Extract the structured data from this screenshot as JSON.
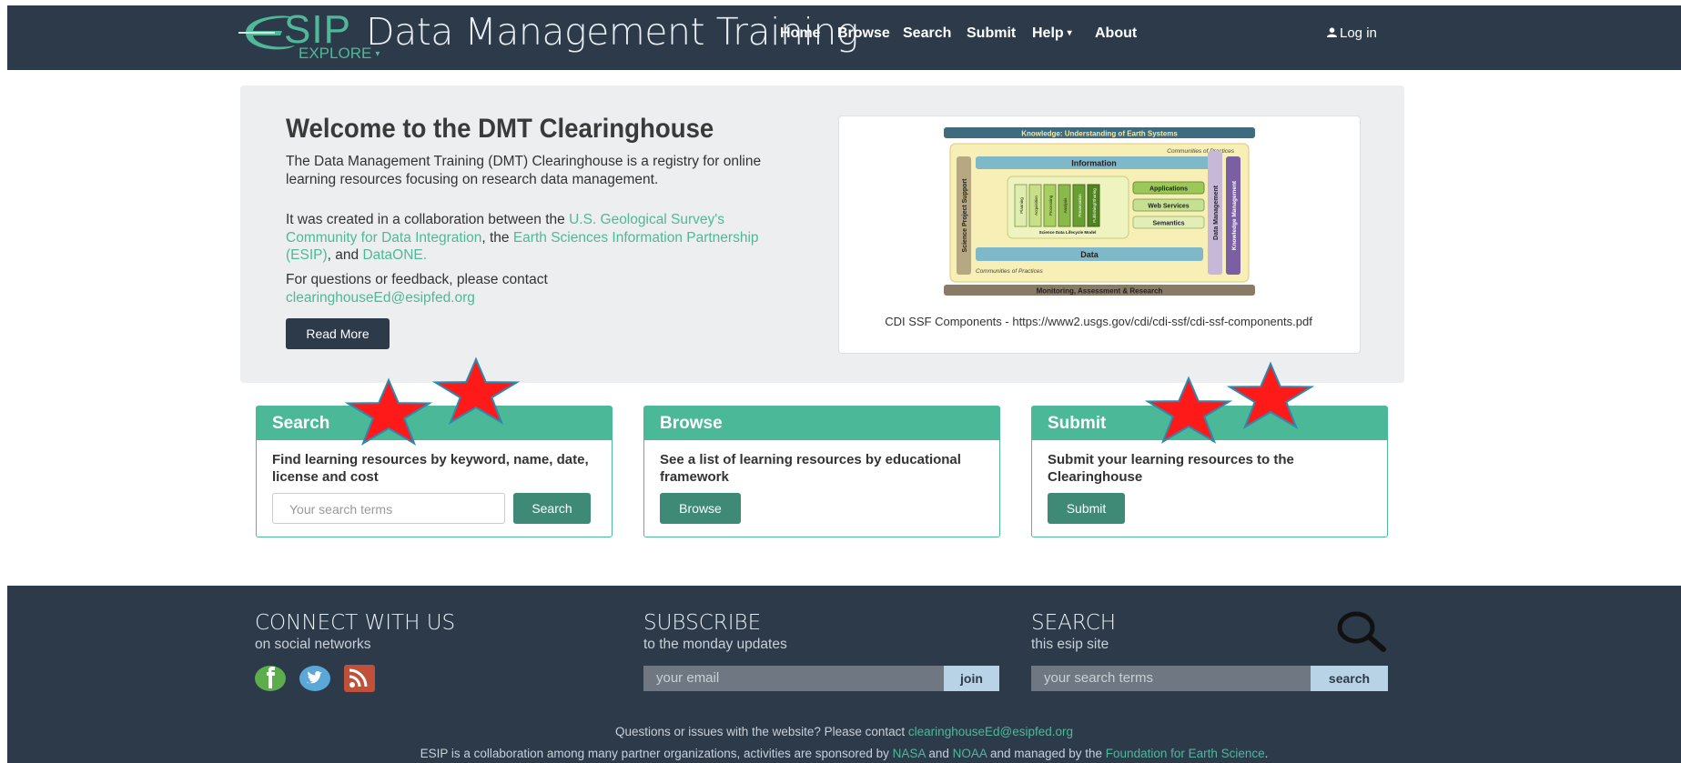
{
  "nav": {
    "logo_letters": "SIP",
    "brand_title": "Data Management Training",
    "explore_label": "EXPLORE",
    "items": [
      "Home",
      "Browse",
      "Search",
      "Submit",
      "Help",
      "About"
    ],
    "login": "Log in"
  },
  "hero": {
    "title": "Welcome to the DMT Clearinghouse",
    "p1": "The Data Management Training (DMT) Clearinghouse is a registry for online learning resources focusing on research data management.",
    "p2_pre": "It was created in a collaboration between the ",
    "p2_link1": "U.S. Geological Survey's Community for Data Integration",
    "p2_mid": ", the ",
    "p2_link2": "Earth Sciences Information Partnership (ESIP)",
    "p2_and": ", and ",
    "p2_link3": "DataONE",
    "p2_end": ".",
    "p3": "For questions or feedback, please contact",
    "p3_email": "clearinghouseEd@esipfed.org",
    "read_more": "Read More",
    "figure_caption": "CDI SSF Components - https://www2.usgs.gov/cdi/cdi-ssf/cdi-ssf-components.pdf",
    "figure": {
      "top_bar": "Knowledge: Understanding of Earth Systems",
      "cop_top": "Communities of Practices",
      "information": "Information",
      "left_bar": "Science Project Support",
      "right_bar1": "Data Management",
      "right_bar2": "Knowledge Management",
      "lifecycle_stages": [
        "Planning",
        "Acquisition",
        "Processing",
        "Analysis",
        "Preservation",
        "Publishing/Sharing"
      ],
      "lifecycle_label": "Science Data Lifecycle Model",
      "boxes": [
        "Applications",
        "Web Services",
        "Semantics"
      ],
      "data": "Data",
      "cop_bottom": "Communities of Practices",
      "bottom_bar": "Monitoring, Assessment & Research"
    }
  },
  "panels": {
    "search": {
      "title": "Search",
      "text": "Find learning resources by keyword, name, date, license and cost",
      "placeholder": "Your search terms",
      "button": "Search"
    },
    "browse": {
      "title": "Browse",
      "text": "See a list of learning resources by educational framework",
      "button": "Browse"
    },
    "submit": {
      "title": "Submit",
      "text": "Submit your learning resources to the Clearinghouse",
      "button": "Submit"
    }
  },
  "footer": {
    "connect_title": "CONNECT WITH US",
    "connect_sub": "on social networks",
    "subscribe_title": "SUBSCRIBE",
    "subscribe_sub": "to the monday updates",
    "email_placeholder": "your email",
    "join": "join",
    "search_title": "SEARCH",
    "search_sub": "this esip site",
    "search_placeholder": "your search terms",
    "search_btn": "search",
    "line1_pre": "Questions or issues with the website? Please contact ",
    "line1_email": "clearinghouseEd@esipfed.org",
    "line2_pre": "ESIP is a collaboration among many partner organizations, activities are sponsored by ",
    "line2_nasa": "NASA",
    "line2_and": " and ",
    "line2_noaa": "NOAA",
    "line2_mid": " and managed by the ",
    "line2_fes": "Foundation for Earth Science",
    "line2_end": "."
  },
  "colors": {
    "navbar": "#2d3a4a",
    "accent": "#4fb89a",
    "panel_head": "#4bb998",
    "button": "#3e8a76",
    "star_fill": "#ff1a1a",
    "star_stroke": "#2a8ab0"
  }
}
